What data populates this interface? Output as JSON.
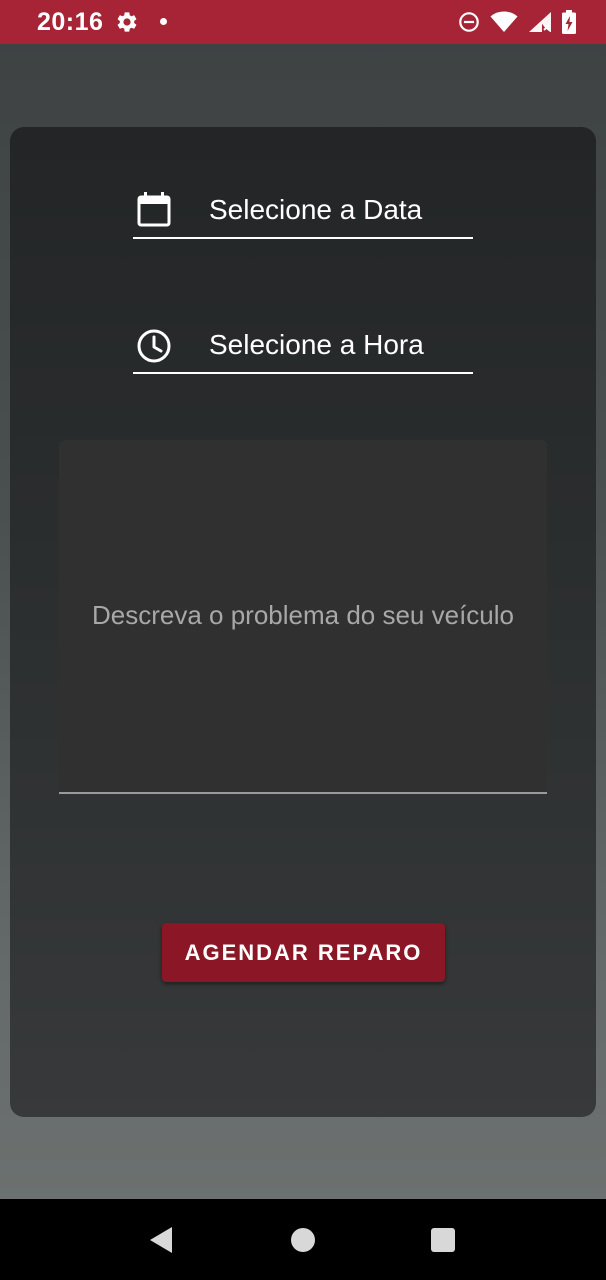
{
  "status_bar": {
    "time": "20:16",
    "background": "#a62436",
    "icons": [
      "gear-icon",
      "notification-dot-icon",
      "do-not-disturb-icon",
      "wifi-icon",
      "cellular-signal-icon",
      "battery-charging-icon"
    ]
  },
  "form": {
    "date_picker": {
      "label": "Selecione a Data",
      "icon": "calendar-icon"
    },
    "time_picker": {
      "label": "Selecione a Hora",
      "icon": "clock-icon"
    },
    "description": {
      "placeholder": "Descreva o problema do seu veículo",
      "value": ""
    },
    "submit_label": "AGENDAR REPARO",
    "accent": "#8b1625"
  },
  "nav_bar": {
    "icons": [
      "back-icon",
      "home-icon",
      "recents-icon"
    ]
  }
}
